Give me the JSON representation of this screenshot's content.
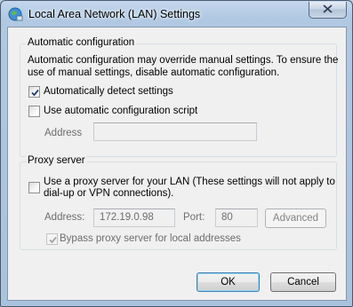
{
  "window": {
    "title": "Local Area Network (LAN) Settings",
    "close_glyph": "✕"
  },
  "auto_config": {
    "legend": "Automatic configuration",
    "description_line1": "Automatic configuration may override manual settings.  To ensure the",
    "description_line2": "use of manual settings, disable automatic configuration.",
    "detect_label": "Automatically detect settings",
    "detect_checked": true,
    "script_label": "Use automatic configuration script",
    "script_checked": false,
    "address_label": "Address",
    "address_value": ""
  },
  "proxy": {
    "legend": "Proxy server",
    "use_proxy_line1": "Use a proxy server for your LAN (These settings will not apply to",
    "use_proxy_line2": "dial-up or VPN connections).",
    "use_proxy_checked": false,
    "address_label": "Address:",
    "address_value": "172.19.0.98",
    "port_label": "Port:",
    "port_value": "80",
    "advanced_label": "Advanced",
    "bypass_label": "Bypass proxy server for local addresses",
    "bypass_checked": true
  },
  "buttons": {
    "ok": "OK",
    "cancel": "Cancel"
  },
  "icons": {
    "app": "network-globe-icon",
    "close": "close-icon",
    "check": "checkmark-icon"
  }
}
